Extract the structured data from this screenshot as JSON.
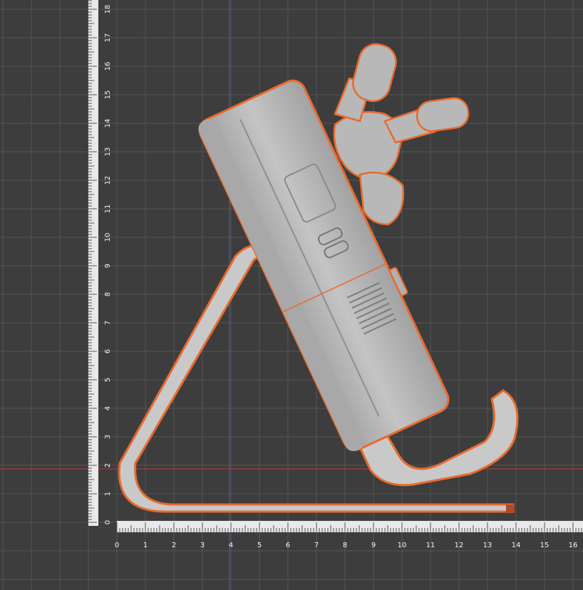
{
  "viewport": {
    "background": "#3d3d3d",
    "grid_color": "#4a4a4a",
    "grid_major_color": "#555555",
    "x_axis_color": "#c43b3b",
    "y_axis_color": "#3b64c4",
    "selection_outline_color": "#e86a2e",
    "model_color": "#b9b9b9"
  },
  "ruler": {
    "units": "cm",
    "horizontal_labels": [
      "0",
      "1",
      "2",
      "3",
      "4",
      "5",
      "6",
      "7",
      "8",
      "9",
      "10",
      "11",
      "12",
      "13",
      "14",
      "15",
      "16"
    ],
    "vertical_labels": [
      "0",
      "1",
      "2",
      "3",
      "4",
      "5",
      "6",
      "7",
      "8",
      "9",
      "10",
      "11",
      "12",
      "13",
      "14",
      "15",
      "16",
      "17",
      "18"
    ]
  },
  "scene": {
    "objects": [
      "triangle-stand",
      "handheld-console",
      "figurine"
    ]
  }
}
